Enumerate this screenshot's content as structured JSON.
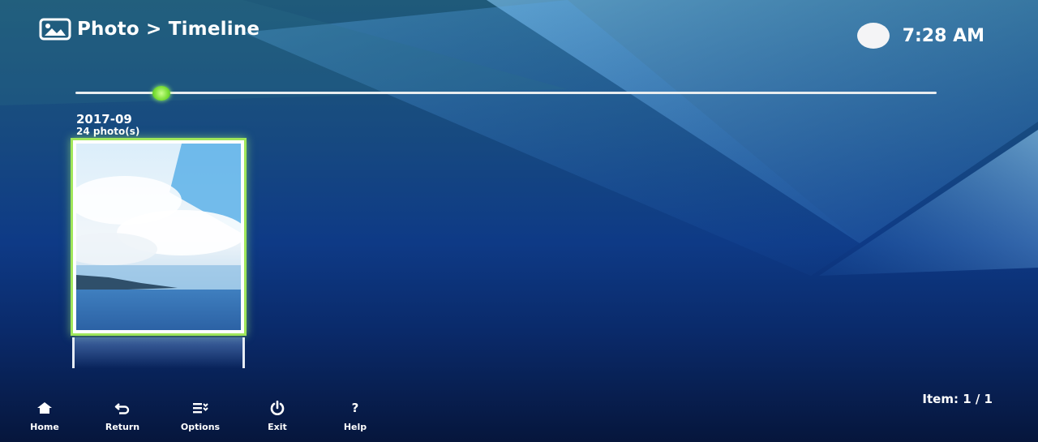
{
  "header": {
    "breadcrumb": "Photo > Timeline",
    "time": "7:28 AM"
  },
  "timeline": {
    "position": 0.1
  },
  "group": {
    "date": "2017-09",
    "count": "24 photo(s)"
  },
  "status": {
    "item_count": "Item: 1 / 1"
  },
  "footer": {
    "home": "Home",
    "return": "Return",
    "options": "Options",
    "exit": "Exit",
    "help": "Help",
    "help_glyph": "?"
  },
  "colors": {
    "focus": "#9fe65a",
    "timeline_handle": "#7ee03a",
    "background_top": "#1f5a7a",
    "background_bottom": "#06163c"
  }
}
